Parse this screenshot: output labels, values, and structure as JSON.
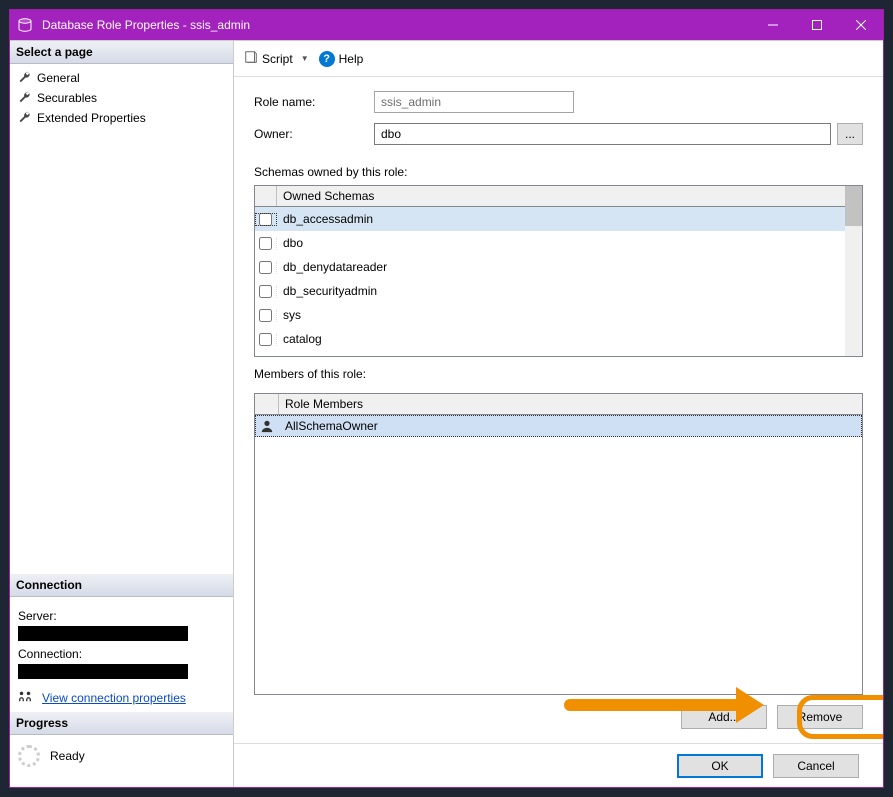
{
  "window": {
    "title": "Database Role Properties - ssis_admin"
  },
  "sidebar": {
    "select_page_header": "Select a page",
    "pages": [
      {
        "label": "General"
      },
      {
        "label": "Securables"
      },
      {
        "label": "Extended Properties"
      }
    ],
    "connection_header": "Connection",
    "server_label": "Server:",
    "connection_label": "Connection:",
    "view_props_link": "View connection properties",
    "progress_header": "Progress",
    "progress_status": "Ready"
  },
  "toolbar": {
    "script_label": "Script",
    "help_label": "Help"
  },
  "form": {
    "role_name_label": "Role name:",
    "role_name_value": "ssis_admin",
    "owner_label": "Owner:",
    "owner_value": "dbo",
    "browse_label": "..."
  },
  "schemas": {
    "section_label": "Schemas owned by this role:",
    "col_header": "Owned Schemas",
    "rows": [
      {
        "name": "db_accessadmin",
        "checked": false
      },
      {
        "name": "dbo",
        "checked": false
      },
      {
        "name": "db_denydatareader",
        "checked": false
      },
      {
        "name": "db_securityadmin",
        "checked": false
      },
      {
        "name": "sys",
        "checked": false
      },
      {
        "name": "catalog",
        "checked": false
      }
    ]
  },
  "members": {
    "section_label": "Members of this role:",
    "col_header": "Role Members",
    "rows": [
      {
        "name": "AllSchemaOwner"
      }
    ],
    "add_label": "Add...",
    "remove_label": "Remove"
  },
  "footer": {
    "ok_label": "OK",
    "cancel_label": "Cancel"
  }
}
